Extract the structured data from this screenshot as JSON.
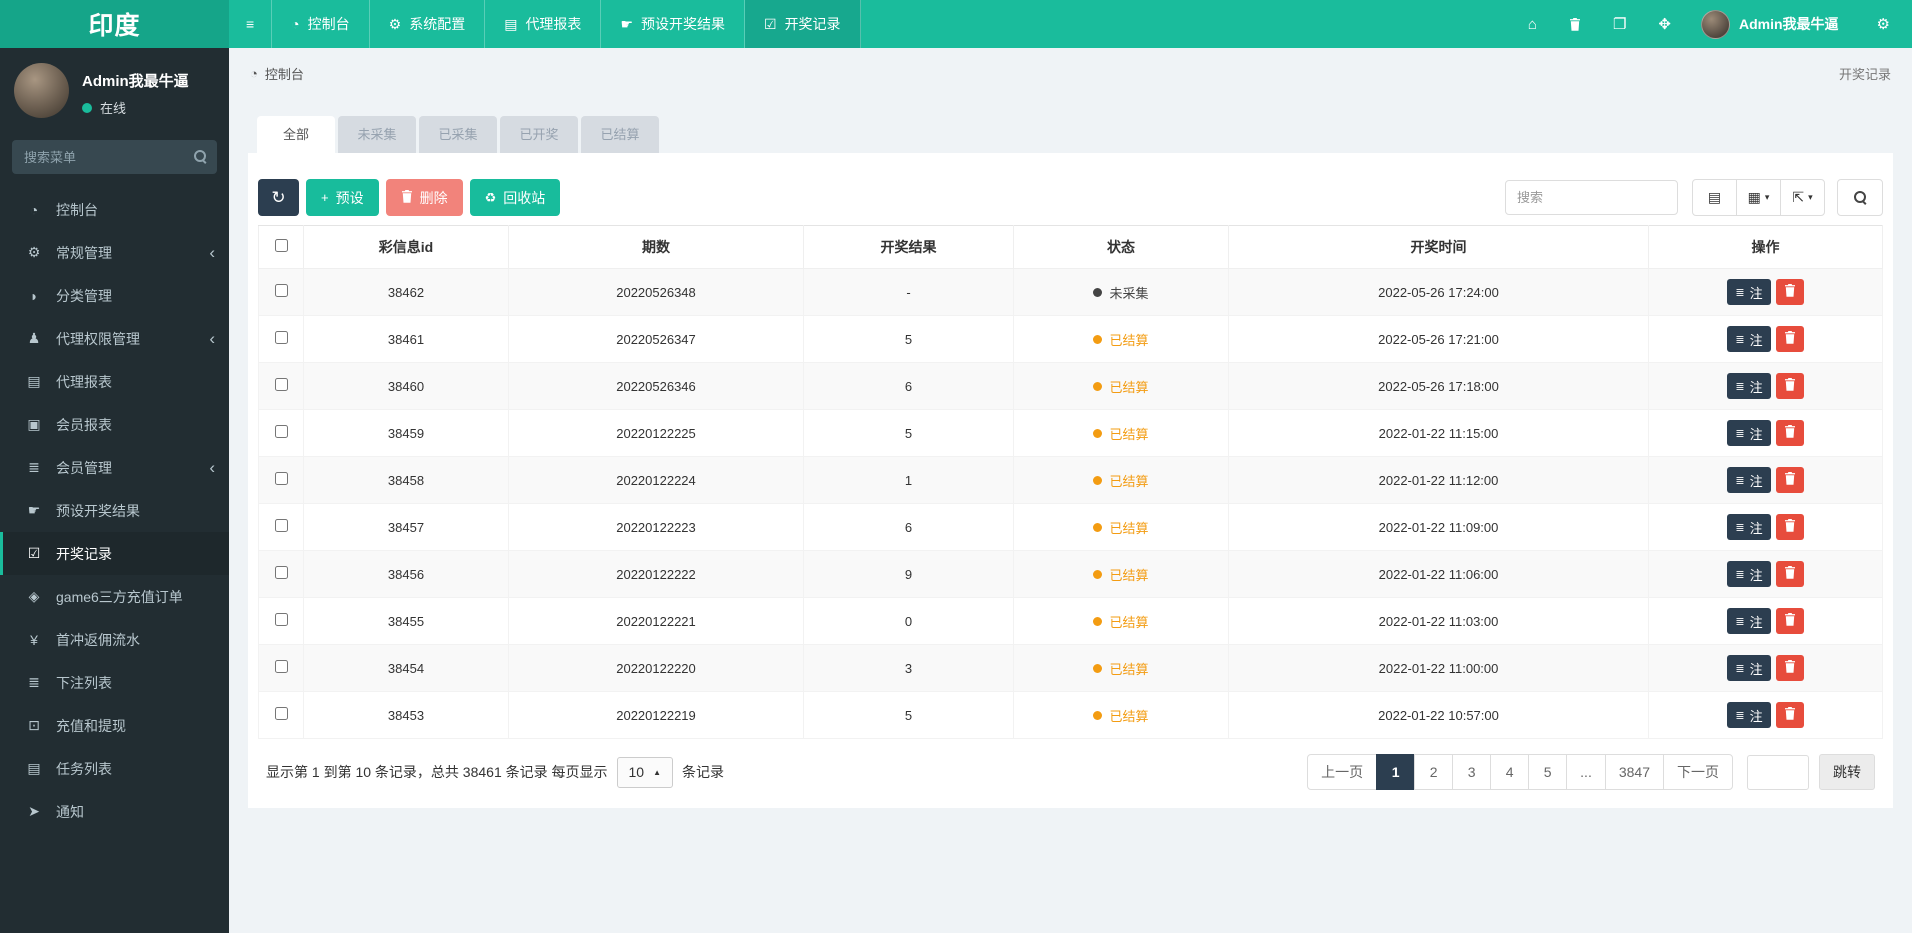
{
  "topbar": {
    "brand": "印度",
    "nav_items": [
      {
        "label": "控制台",
        "icon": "dashboard-icon",
        "glyph": "◔",
        "active": false
      },
      {
        "label": "系统配置",
        "icon": "gear-icon",
        "glyph": "⚙",
        "active": false
      },
      {
        "label": "代理报表",
        "icon": "book-icon",
        "glyph": "▤",
        "active": false
      },
      {
        "label": "预设开奖结果",
        "icon": "hand-pointer-icon",
        "glyph": "☛",
        "active": false
      },
      {
        "label": "开奖记录",
        "icon": "calendar-check-icon",
        "glyph": "☑",
        "active": true
      }
    ],
    "right_icons": [
      {
        "name": "home-icon",
        "glyph": "⌂"
      },
      {
        "name": "trash-icon",
        "glyph": "svg-trash"
      },
      {
        "name": "copy-icon",
        "glyph": "❐"
      },
      {
        "name": "expand-icon",
        "glyph": "✥"
      }
    ],
    "user_name": "Admin我最牛逼",
    "settings_glyph": "⚙"
  },
  "sidebar": {
    "user_name": "Admin我最牛逼",
    "status": "在线",
    "search_placeholder": "搜索菜单",
    "items": [
      {
        "label": "控制台",
        "icon": "dashboard-icon",
        "glyph": "◔",
        "chevron": false,
        "active": false
      },
      {
        "label": "常规管理",
        "icon": "cogs-icon",
        "glyph": "⚙",
        "chevron": true,
        "active": false
      },
      {
        "label": "分类管理",
        "icon": "leaf-icon",
        "glyph": "◗",
        "chevron": false,
        "active": false
      },
      {
        "label": "代理权限管理",
        "icon": "users-icon",
        "glyph": "♟",
        "chevron": true,
        "active": false
      },
      {
        "label": "代理报表",
        "icon": "book-icon",
        "glyph": "▤",
        "chevron": false,
        "active": false
      },
      {
        "label": "会员报表",
        "icon": "id-card-icon",
        "glyph": "▣",
        "chevron": false,
        "active": false
      },
      {
        "label": "会员管理",
        "icon": "list-icon",
        "glyph": "≣",
        "chevron": true,
        "active": false
      },
      {
        "label": "预设开奖结果",
        "icon": "hand-pointer-icon",
        "glyph": "☛",
        "chevron": false,
        "active": false
      },
      {
        "label": "开奖记录",
        "icon": "calendar-check-icon",
        "glyph": "☑",
        "chevron": false,
        "active": true
      },
      {
        "label": "game6三方充值订单",
        "icon": "gem-icon",
        "glyph": "◈",
        "chevron": false,
        "active": false
      },
      {
        "label": "首冲返佣流水",
        "icon": "yen-icon",
        "glyph": "¥",
        "chevron": false,
        "active": false
      },
      {
        "label": "下注列表",
        "icon": "list-icon",
        "glyph": "≣",
        "chevron": false,
        "active": false
      },
      {
        "label": "充值和提现",
        "icon": "money-icon",
        "glyph": "⊡",
        "chevron": false,
        "active": false
      },
      {
        "label": "任务列表",
        "icon": "tasks-icon",
        "glyph": "▤",
        "chevron": false,
        "active": false
      },
      {
        "label": "通知",
        "icon": "bullhorn-icon",
        "glyph": "➤",
        "chevron": false,
        "active": false
      }
    ]
  },
  "breadcrumb": {
    "icon_glyph": "◔",
    "current": "控制台",
    "page_title": "开奖记录"
  },
  "tabs": [
    {
      "label": "全部",
      "active": true
    },
    {
      "label": "未采集",
      "active": false
    },
    {
      "label": "已采集",
      "active": false
    },
    {
      "label": "已开奖",
      "active": false
    },
    {
      "label": "已结算",
      "active": false
    }
  ],
  "toolbar": {
    "refresh_glyph": "↻",
    "preset_label": "预设",
    "delete_label": "删除",
    "recycle_label": "回收站",
    "recycle_glyph": "♻",
    "search_placeholder": "搜索",
    "view_buttons": [
      {
        "name": "detail-view-icon",
        "glyph": "▤",
        "caret": false
      },
      {
        "name": "columns-toggle-icon",
        "glyph": "▦",
        "caret": true
      },
      {
        "name": "export-icon",
        "glyph": "⇱",
        "caret": true
      }
    ]
  },
  "table": {
    "columns": [
      "彩信息id",
      "期数",
      "开奖结果",
      "状态",
      "开奖时间",
      "操作"
    ],
    "note_label": "注",
    "rows": [
      {
        "id": "38462",
        "issue": "20220526348",
        "result": "-",
        "status": "未采集",
        "status_type": "pending",
        "time": "2022-05-26 17:24:00"
      },
      {
        "id": "38461",
        "issue": "20220526347",
        "result": "5",
        "status": "已结算",
        "status_type": "settled",
        "time": "2022-05-26 17:21:00"
      },
      {
        "id": "38460",
        "issue": "20220526346",
        "result": "6",
        "status": "已结算",
        "status_type": "settled",
        "time": "2022-05-26 17:18:00"
      },
      {
        "id": "38459",
        "issue": "20220122225",
        "result": "5",
        "status": "已结算",
        "status_type": "settled",
        "time": "2022-01-22 11:15:00"
      },
      {
        "id": "38458",
        "issue": "20220122224",
        "result": "1",
        "status": "已结算",
        "status_type": "settled",
        "time": "2022-01-22 11:12:00"
      },
      {
        "id": "38457",
        "issue": "20220122223",
        "result": "6",
        "status": "已结算",
        "status_type": "settled",
        "time": "2022-01-22 11:09:00"
      },
      {
        "id": "38456",
        "issue": "20220122222",
        "result": "9",
        "status": "已结算",
        "status_type": "settled",
        "time": "2022-01-22 11:06:00"
      },
      {
        "id": "38455",
        "issue": "20220122221",
        "result": "0",
        "status": "已结算",
        "status_type": "settled",
        "time": "2022-01-22 11:03:00"
      },
      {
        "id": "38454",
        "issue": "20220122220",
        "result": "3",
        "status": "已结算",
        "status_type": "settled",
        "time": "2022-01-22 11:00:00"
      },
      {
        "id": "38453",
        "issue": "20220122219",
        "result": "5",
        "status": "已结算",
        "status_type": "settled",
        "time": "2022-01-22 10:57:00"
      }
    ]
  },
  "footer": {
    "summary_prefix": "显示第 1 到第 10 条记录，总共 38461 条记录 每页显示",
    "page_size": "10",
    "summary_suffix": "条记录",
    "pages": [
      "上一页",
      "1",
      "2",
      "3",
      "4",
      "5",
      "...",
      "3847",
      "下一页"
    ],
    "active_page": "1",
    "jump_label": "跳转"
  },
  "colors": {
    "teal": "#1abc9c",
    "teal_dark": "#15a589",
    "navy": "#2c3e50",
    "red": "#e74c3c",
    "salmon": "#f2837b",
    "orange": "#f39c12",
    "sidebar_bg": "#222d32",
    "content_bg": "#eff3f6"
  }
}
